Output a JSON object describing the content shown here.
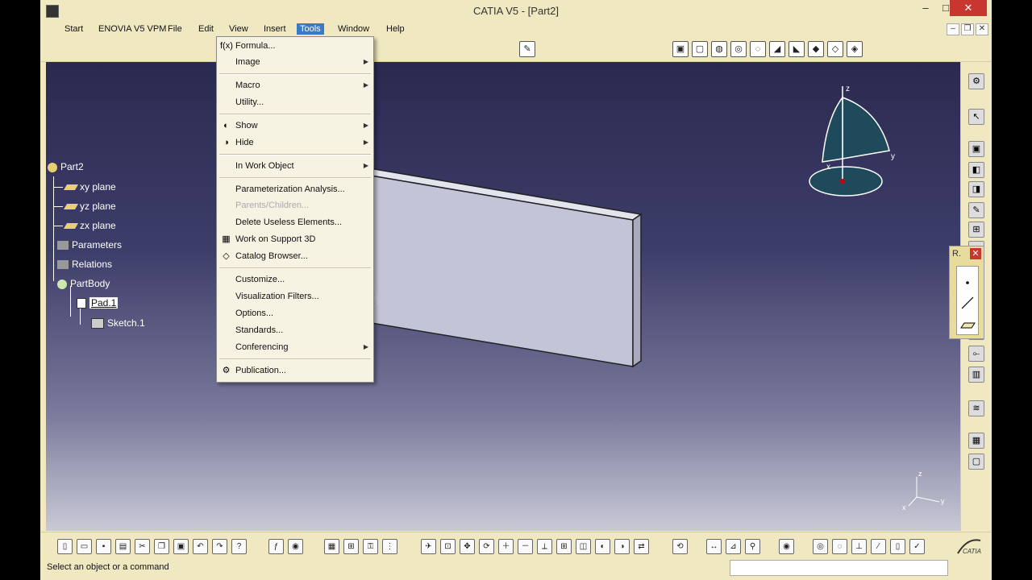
{
  "window": {
    "title": "CATIA V5 - [Part2]",
    "minimize": "–",
    "maximize": "□",
    "close": "✕"
  },
  "menubar": {
    "items": [
      "Start",
      "ENOVIA V5 VPM",
      "File",
      "Edit",
      "View",
      "Insert",
      "Tools",
      "Window",
      "Help"
    ],
    "active_index": 6
  },
  "mdi": {
    "minimize": "–",
    "restore": "❐",
    "close": "✕"
  },
  "tools_menu": {
    "items": [
      {
        "label": "Formula...",
        "icon": "formula-icon",
        "glyph": "f(x)",
        "submenu": false,
        "disabled": false
      },
      {
        "label": "Image",
        "submenu": true,
        "disabled": false
      },
      {
        "label": "Macro",
        "submenu": true,
        "disabled": false
      },
      {
        "label": "Utility...",
        "submenu": false,
        "disabled": false
      },
      {
        "label": "Show",
        "icon": "show-icon",
        "glyph": "◐",
        "submenu": true,
        "disabled": false
      },
      {
        "label": "Hide",
        "icon": "hide-icon",
        "glyph": "◑",
        "submenu": true,
        "disabled": false
      },
      {
        "label": "In Work Object",
        "submenu": true,
        "disabled": false
      },
      {
        "label": "Parameterization Analysis...",
        "submenu": false,
        "disabled": false
      },
      {
        "label": "Parents/Children...",
        "submenu": false,
        "disabled": true
      },
      {
        "label": "Delete Useless Elements...",
        "submenu": false,
        "disabled": false
      },
      {
        "label": "Work on Support 3D",
        "icon": "grid-icon",
        "glyph": "▦",
        "submenu": false,
        "disabled": false
      },
      {
        "label": "Catalog Browser...",
        "icon": "catalog-icon",
        "glyph": "◇",
        "submenu": false,
        "disabled": false
      },
      {
        "label": "Customize...",
        "submenu": false,
        "disabled": false
      },
      {
        "label": "Visualization Filters...",
        "submenu": false,
        "disabled": false
      },
      {
        "label": "Options...",
        "submenu": false,
        "disabled": false
      },
      {
        "label": "Standards...",
        "submenu": false,
        "disabled": false
      },
      {
        "label": "Conferencing",
        "submenu": true,
        "disabled": false
      },
      {
        "label": "Publication...",
        "icon": "publication-icon",
        "glyph": "⚙",
        "submenu": false,
        "disabled": false
      }
    ]
  },
  "tree": {
    "root": "Part2",
    "planes": [
      "xy plane",
      "yz plane",
      "zx plane"
    ],
    "parameters": "Parameters",
    "relations": "Relations",
    "partbody": "PartBody",
    "pad": "Pad.1",
    "sketch": "Sketch.1"
  },
  "compass": {
    "z": "z",
    "y": "y",
    "x": "x"
  },
  "mini_axes": {
    "z": "z",
    "y": "y",
    "x": "x"
  },
  "r_panel": {
    "title": "R.",
    "close": "✕"
  },
  "status": {
    "prompt": "Select an object or a command"
  },
  "brand": {
    "logo_text": "CATIA"
  },
  "colors": {
    "menu_highlight": "#3a78c8",
    "viewport_top": "#2a2a50",
    "viewport_bottom": "#c9c9d6",
    "close_red": "#c7372f"
  }
}
